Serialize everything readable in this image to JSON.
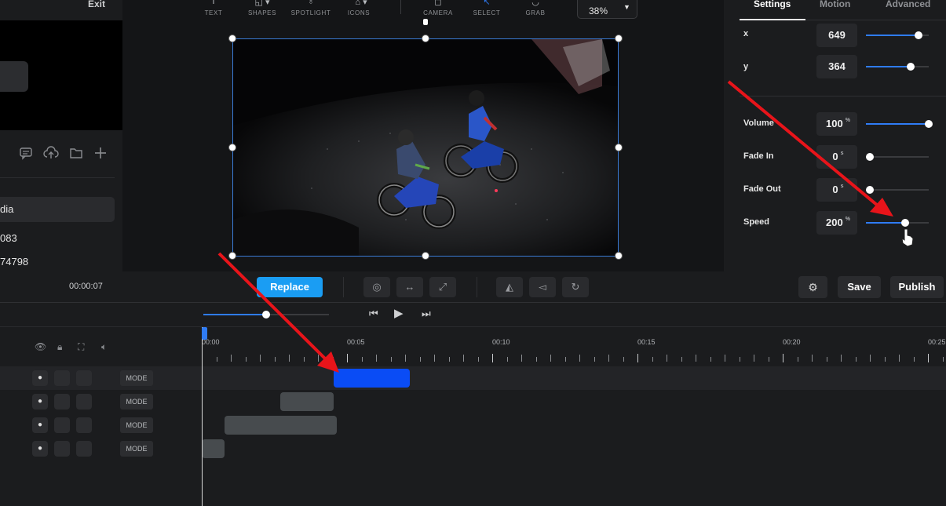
{
  "left_panel": {
    "exit_label": "Exit",
    "media_tab_label": "dia",
    "value_1": "083",
    "value_2": "74798",
    "time": "00:00:07",
    "icons": [
      "comment-icon",
      "upload-cloud-icon",
      "folder-icon",
      "plus-icon"
    ]
  },
  "canvas_toolbar": {
    "tools": [
      {
        "label": "TEXT",
        "icon": "text-icon"
      },
      {
        "label": "SHAPES",
        "icon": "shapes-icon"
      },
      {
        "label": "SPOTLIGHT",
        "icon": "spotlight-icon"
      },
      {
        "label": "ICONS",
        "icon": "icons-icon"
      },
      {
        "label": "CAMERA",
        "icon": "camera-icon"
      },
      {
        "label": "SELECT",
        "icon": "select-cursor-icon"
      },
      {
        "label": "GRAB",
        "icon": "grab-hand-icon"
      }
    ],
    "zoom": "38%"
  },
  "right_panel": {
    "tabs": [
      "Settings",
      "Motion",
      "Advanced"
    ],
    "active_tab": "Settings",
    "props": [
      {
        "label": "x",
        "value": "649",
        "unit": "",
        "level": 0.83
      },
      {
        "label": "y",
        "value": "364",
        "unit": "",
        "level": 0.69
      },
      {
        "label": "Volume",
        "value": "100",
        "unit": "%",
        "level": 1.0
      },
      {
        "label": "Fade In",
        "value": "0",
        "unit": "s",
        "level": 0.0
      },
      {
        "label": "Fade Out",
        "value": "0",
        "unit": "s",
        "level": 0.0
      },
      {
        "label": "Speed",
        "value": "200",
        "unit": "%",
        "level": 0.6
      }
    ]
  },
  "toolbar": {
    "replace_label": "Replace",
    "save_label": "Save",
    "publish_label": "Publish"
  },
  "playback": {
    "volume_level": 0.5
  },
  "timeline": {
    "tick_labels": [
      "00:00",
      "00:05",
      "00:10",
      "00:15",
      "00:20",
      "00:25"
    ],
    "mode_label": "MODE",
    "colors": {
      "selected_clip": "#0a4cf5",
      "clip": "#474b4e",
      "accent": "#2f7cf6",
      "replace": "#1a9df3",
      "arrow": "#e8141a"
    }
  }
}
